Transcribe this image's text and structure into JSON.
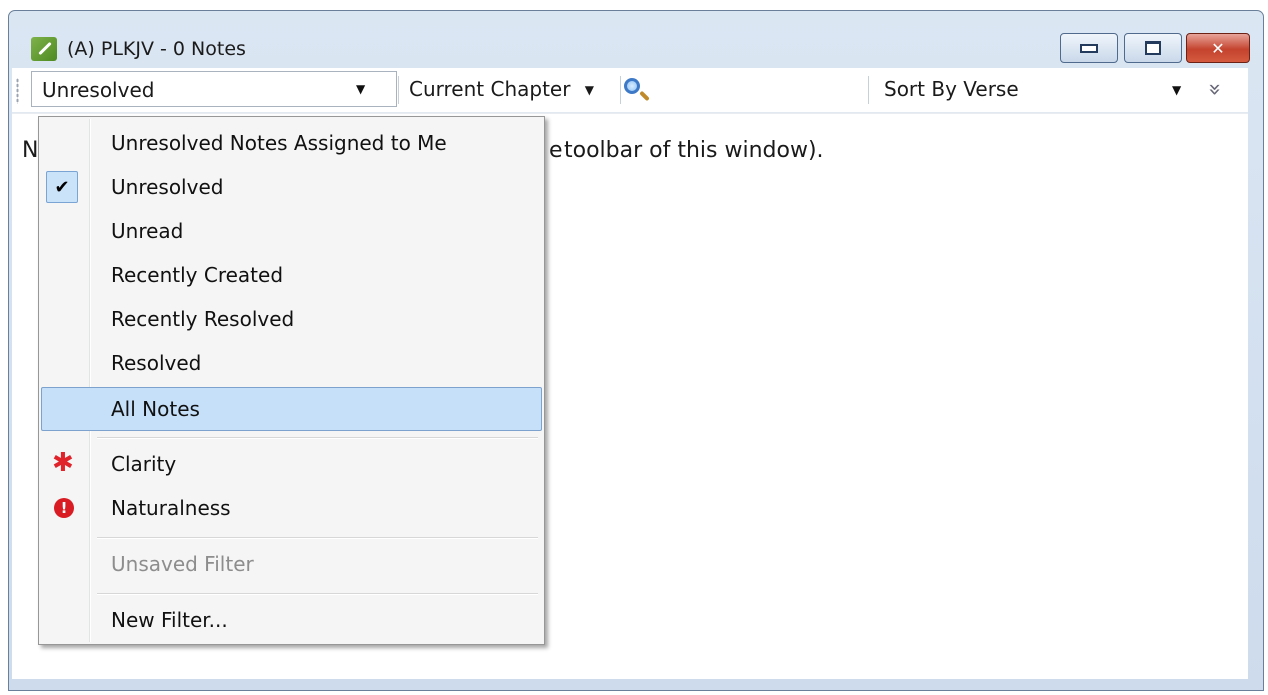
{
  "window": {
    "title": "(A) PLKJV - 0 Notes",
    "buttons": {
      "minimize": "minimize",
      "maximize": "maximize",
      "close": "close"
    }
  },
  "toolbar": {
    "filter_value": "Unresolved",
    "scope_label": "Current Chapter",
    "search_placeholder": "",
    "sort_value": "Sort By Verse",
    "overflow_glyph": "»"
  },
  "content": {
    "message_visible": "toolbar of this window).",
    "leading_char": "N",
    "leading_fragment": "e"
  },
  "filter_menu": {
    "items": [
      {
        "label": "Unresolved Notes Assigned to Me",
        "checked": false
      },
      {
        "label": "Unresolved",
        "checked": true
      },
      {
        "label": "Unread",
        "checked": false
      },
      {
        "label": "Recently Created",
        "checked": false
      },
      {
        "label": "Recently Resolved",
        "checked": false
      },
      {
        "label": "Resolved",
        "checked": false
      },
      {
        "label": "All Notes",
        "checked": false,
        "highlighted": true
      }
    ],
    "tag_items": [
      {
        "label": "Clarity",
        "icon": "asterisk-icon",
        "color": "#e0232a"
      },
      {
        "label": "Naturalness",
        "icon": "exclamation-icon",
        "color": "#d91c24"
      }
    ],
    "unsaved_item": "Unsaved Filter",
    "new_filter_item": "New Filter..."
  },
  "colors": {
    "highlight": "#c6e0fa",
    "title_bg": "#dbe6f3"
  }
}
